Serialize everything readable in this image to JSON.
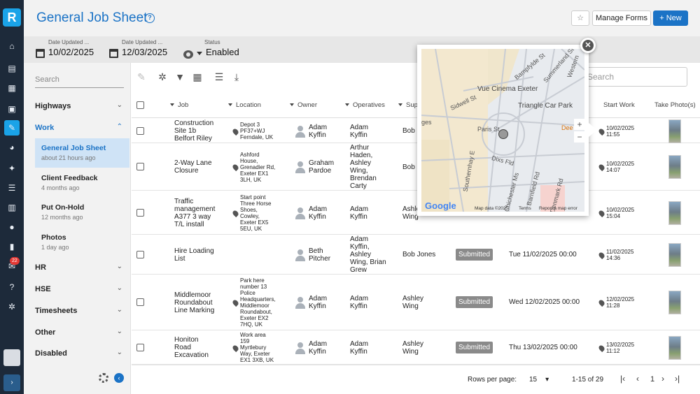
{
  "app": {
    "logo_letter": "R"
  },
  "header": {
    "title": "General Job Sheet",
    "help_glyph": "?",
    "star_glyph": "☆",
    "manage_forms": "Manage Forms",
    "new_button": "New"
  },
  "filters": [
    {
      "label": "Date Updated ...",
      "value": "10/02/2025"
    },
    {
      "label": "Date Updated ...",
      "value": "12/03/2025"
    },
    {
      "label": "Status",
      "value": "Enabled"
    }
  ],
  "sidebar": {
    "search_placeholder": "Search",
    "sections": {
      "highways": "Highways",
      "work": "Work",
      "hr": "HR",
      "hse": "HSE",
      "timesheets": "Timesheets",
      "other": "Other",
      "disabled": "Disabled"
    },
    "work_items": [
      {
        "name": "General Job Sheet",
        "time": "about 21 hours ago"
      },
      {
        "name": "Client Feedback",
        "time": "4 months ago"
      },
      {
        "name": "Put On-Hold",
        "time": "12 months ago"
      },
      {
        "name": "Photos",
        "time": "1 day ago"
      }
    ],
    "notification_count": "22"
  },
  "toolbar": {
    "search_placeholder": "Search"
  },
  "table": {
    "columns": {
      "job": "Job",
      "location": "Location",
      "owner": "Owner",
      "operatives": "Operatives",
      "supervisor": "Sup",
      "start_work": "Start Work",
      "take_photos": "Take Photo(s)"
    },
    "rows": [
      {
        "job": [
          "Construction",
          "Site 1b",
          "Belfort Riley"
        ],
        "location": [
          "Depot 3",
          "PF37+WJ",
          "Ferndale, UK"
        ],
        "owner": [
          "Adam",
          "Kyffin"
        ],
        "operatives": [
          "Adam",
          "Kyffin"
        ],
        "supervisor": [
          "Bob"
        ],
        "status": "",
        "date": "",
        "start_work": [
          "10/02/2025",
          "11:55"
        ]
      },
      {
        "job": [
          "2-Way Lane",
          "Closure"
        ],
        "location": [
          "Ashford",
          "House,",
          "Grenadier Rd,",
          "Exeter EX1",
          "3LH, UK"
        ],
        "owner": [
          "Graham",
          "Pardoe"
        ],
        "operatives": [
          "Arthur",
          "Haden,",
          "Ashley",
          "Wing,",
          "Brendan",
          "Carty"
        ],
        "supervisor": [
          "Bob"
        ],
        "status": "",
        "date": "",
        "start_work": [
          "10/02/2025",
          "14:07"
        ]
      },
      {
        "job": [
          "Traffic",
          "management",
          "A377 3 way",
          "T/L install"
        ],
        "location": [
          "Start point",
          "Three Horse",
          "Shoes,",
          "Cowley,",
          "Exeter EX5",
          "5EU, UK"
        ],
        "owner": [
          "Adam",
          "Kyffin"
        ],
        "operatives": [
          "Adam",
          "Kyffin"
        ],
        "supervisor": [
          "Ashle",
          "Wing"
        ],
        "status": "",
        "date": "",
        "start_work": [
          "10/02/2025",
          "15:04"
        ]
      },
      {
        "job": [
          "Hire Loading",
          "List"
        ],
        "location": [],
        "owner": [
          "Beth",
          "Pitcher"
        ],
        "operatives": [
          "Adam",
          "Kyffin,",
          "Ashley",
          "Wing, Brian",
          "Grew"
        ],
        "supervisor": [
          "Bob Jones"
        ],
        "status": "Submitted",
        "date": "Tue 11/02/2025 00:00",
        "start_work": [
          "11/02/2025",
          "14:36"
        ]
      },
      {
        "job": [
          "Middlemoor",
          "Roundabout",
          "Line Marking"
        ],
        "location": [
          "Park here",
          "number 13",
          "Police",
          "Headquarters,",
          "Middlemoor",
          "Roundabout,",
          "Exeter EX2",
          "7HQ, UK"
        ],
        "owner": [
          "Adam",
          "Kyffin"
        ],
        "operatives": [
          "Adam",
          "Kyffin"
        ],
        "supervisor": [
          "Ashley",
          "Wing"
        ],
        "status": "Submitted",
        "date": "Wed 12/02/2025 00:00",
        "start_work": [
          "12/02/2025",
          "11:28"
        ]
      },
      {
        "job": [
          "Honiton",
          "Road",
          "Excavation"
        ],
        "location": [
          "Work area",
          "159",
          "Myrtlebury",
          "Way, Exeter",
          "EX1 3XB, UK"
        ],
        "owner": [
          "Adam",
          "Kyffin"
        ],
        "operatives": [
          "Adam",
          "Kyffin"
        ],
        "supervisor": [
          "Ashley",
          "Wing"
        ],
        "status": "Submitted",
        "date": "Thu 13/02/2025 00:00",
        "start_work": [
          "13/02/2025",
          "11:12"
        ]
      }
    ]
  },
  "pagination": {
    "rows_per_page_label": "Rows per page:",
    "rows_per_page": "15",
    "range": "1-15 of 29",
    "page": "1"
  },
  "map": {
    "labels": {
      "vue": "Vue Cinema Exeter",
      "triangle": "Triangle Car Park",
      "sidwell": "Sidwell St",
      "paris": "Paris St",
      "dixs": "Dixs Fld",
      "southernhay": "Southernhay E",
      "bampfylde": "Bampfylde St",
      "summerland": "Summerland St",
      "western": "Western",
      "chichester": "Chichester Ms",
      "barnfield": "Barnfield Rd",
      "denmark": "Denmark Rd",
      "dee": "Dee",
      "ges": "ges"
    },
    "google": "Google",
    "map_data": "Map data ©2025",
    "terms": "Terms",
    "report": "Report a map error",
    "zoom_in": "+",
    "zoom_out": "−",
    "close_glyph": "✕"
  }
}
